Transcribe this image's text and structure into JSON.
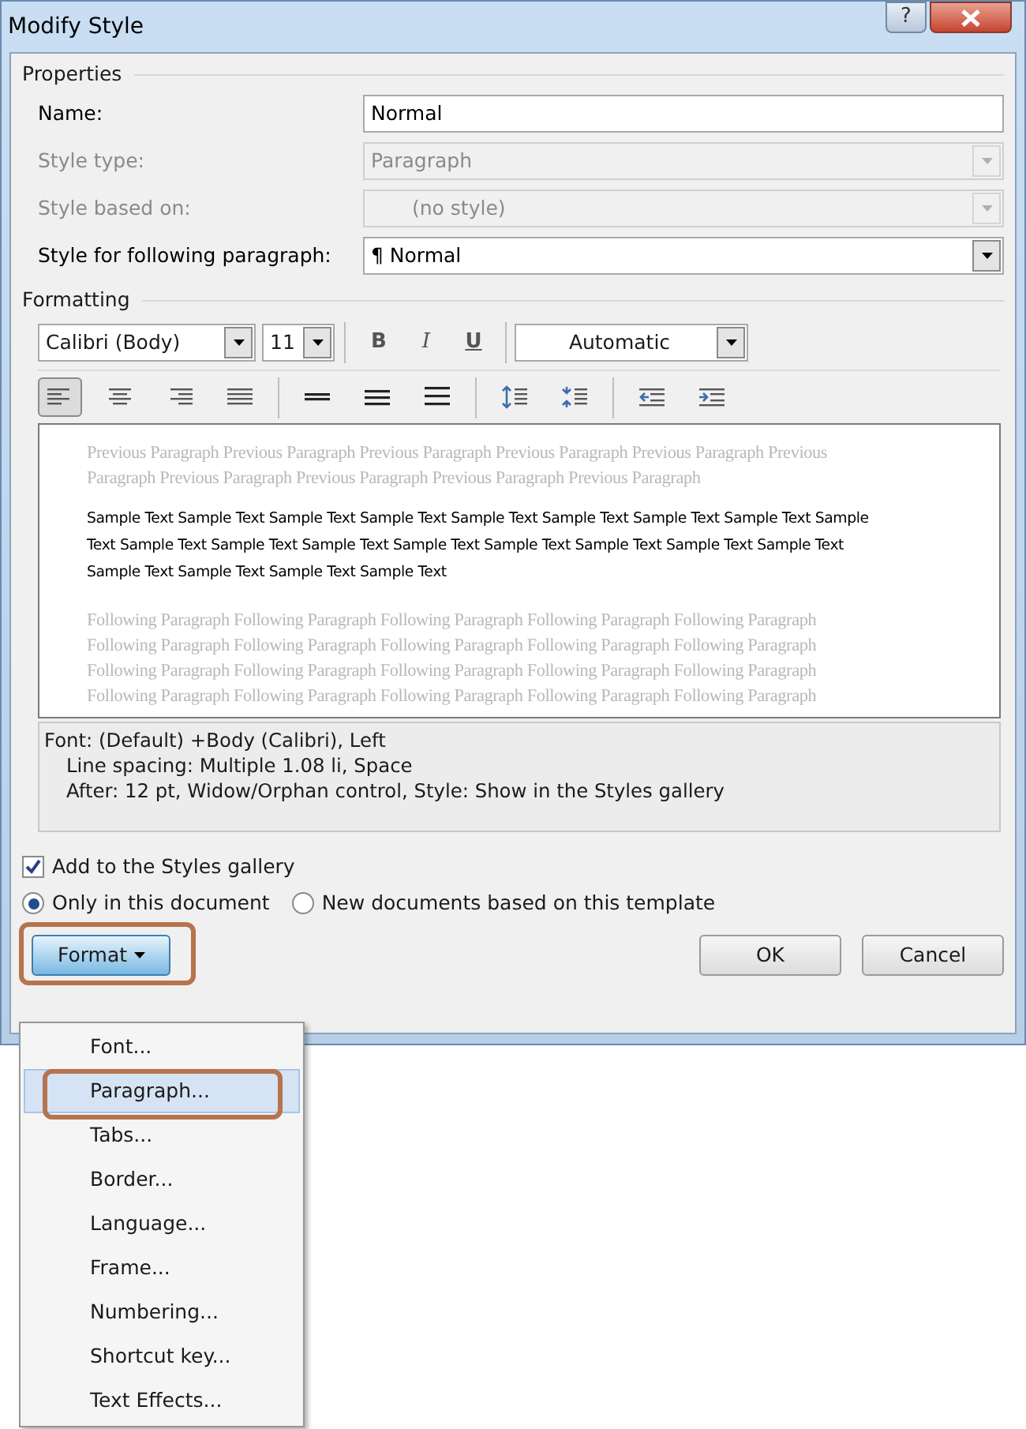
{
  "window": {
    "title": "Modify Style",
    "help_button": "?"
  },
  "properties": {
    "heading": "Properties",
    "fields": [
      {
        "label": "Name:",
        "kind": "text",
        "value": "Normal",
        "disabled": false
      },
      {
        "label": "Style type:",
        "kind": "dropdown",
        "value": "Paragraph",
        "disabled": true
      },
      {
        "label": "Style based on:",
        "kind": "dropdown",
        "value": "(no style)",
        "disabled": true
      },
      {
        "label": "Style for following paragraph:",
        "kind": "dropdown",
        "value": "¶ Normal",
        "disabled": false
      }
    ]
  },
  "formatting": {
    "heading": "Formatting",
    "font": "Calibri (Body)",
    "size": "11",
    "style_buttons": [
      {
        "label": "B",
        "kind": "bold"
      },
      {
        "label": "I",
        "kind": "italic"
      },
      {
        "label": "U",
        "kind": "underline"
      }
    ],
    "font_color": "Automatic",
    "paragraph_buttons": [
      {
        "kind": "align-left",
        "selected": true
      },
      {
        "kind": "align-center",
        "selected": false
      },
      {
        "kind": "align-right",
        "selected": false
      },
      {
        "kind": "justify",
        "selected": false
      },
      {
        "kind": "single",
        "selected": false
      },
      {
        "kind": "one-half",
        "selected": false
      },
      {
        "kind": "double",
        "selected": false
      },
      {
        "kind": "space-up",
        "selected": false
      },
      {
        "kind": "space-down",
        "selected": false
      },
      {
        "kind": "outdent",
        "selected": false
      },
      {
        "kind": "indent",
        "selected": false
      }
    ],
    "preview": {
      "previous": [
        "Previous Paragraph Previous Paragraph Previous Paragraph Previous Paragraph Previous Paragraph Previous",
        "Paragraph Previous Paragraph Previous Paragraph Previous Paragraph Previous Paragraph"
      ],
      "sample": [
        "Sample Text Sample Text Sample Text Sample Text Sample Text Sample Text Sample Text Sample Text Sample",
        "Text Sample Text Sample Text Sample Text Sample Text Sample Text Sample Text Sample Text Sample Text",
        "Sample Text Sample Text Sample Text Sample Text"
      ],
      "following": [
        "Following Paragraph Following Paragraph Following Paragraph Following Paragraph Following Paragraph",
        "Following Paragraph Following Paragraph Following Paragraph Following Paragraph Following Paragraph",
        "Following Paragraph Following Paragraph Following Paragraph Following Paragraph Following Paragraph",
        "Following Paragraph Following Paragraph Following Paragraph Following Paragraph Following Paragraph"
      ]
    },
    "description": [
      "Font: (Default) +Body (Calibri), Left",
      "Line spacing:  Multiple 1.08 li, Space",
      "After:  12 pt, Widow/Orphan control, Style: Show in the Styles gallery"
    ]
  },
  "add_to_gallery": {
    "label": "Add to the Styles gallery",
    "checked": true
  },
  "scope": [
    {
      "label": "Only in this document",
      "selected": true
    },
    {
      "label": "New documents based on this template",
      "selected": false
    }
  ],
  "format_button": {
    "label": "Format",
    "highlighted": true
  },
  "buttons": [
    "OK",
    "Cancel"
  ],
  "format_menu": [
    {
      "label": "Font...",
      "selected": false,
      "highlighted": false
    },
    {
      "label": "Paragraph...",
      "selected": true,
      "highlighted": true
    },
    {
      "label": "Tabs...",
      "selected": false,
      "highlighted": false
    },
    {
      "label": "Border...",
      "selected": false,
      "highlighted": false
    },
    {
      "label": "Language...",
      "selected": false,
      "highlighted": false
    },
    {
      "label": "Frame...",
      "selected": false,
      "highlighted": false
    },
    {
      "label": "Numbering...",
      "selected": false,
      "highlighted": false
    },
    {
      "label": "Shortcut key...",
      "selected": false,
      "highlighted": false
    },
    {
      "label": "Text Effects...",
      "selected": false,
      "highlighted": false
    }
  ]
}
